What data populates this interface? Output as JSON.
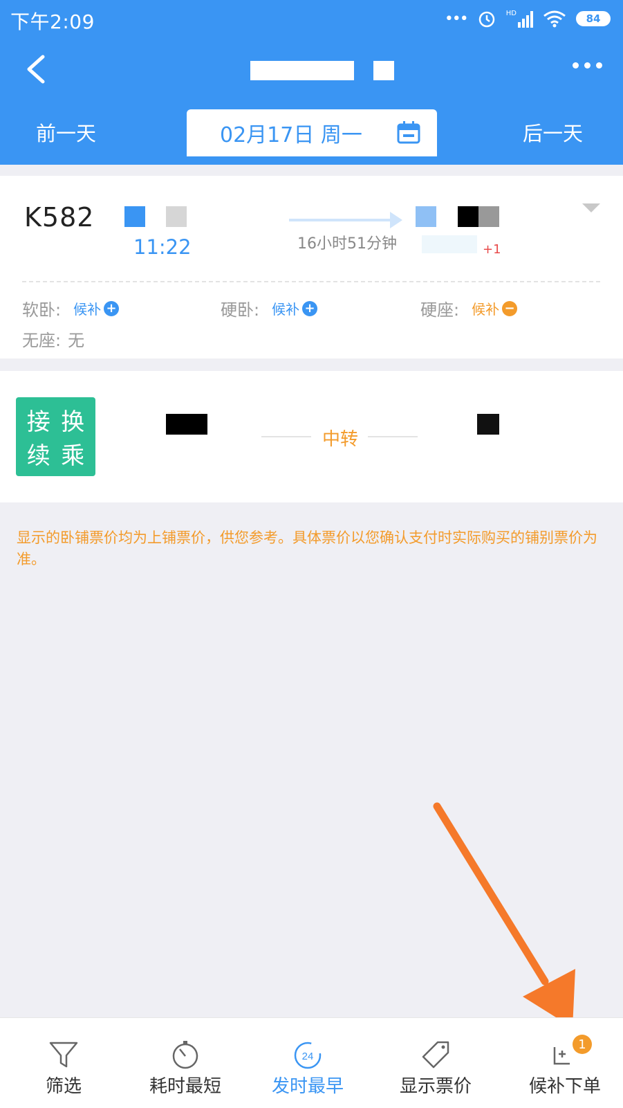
{
  "status_bar": {
    "time": "下午2:09",
    "battery": "84",
    "signal_label": "HD"
  },
  "header": {
    "prev_day": "前一天",
    "next_day": "后一天",
    "date": "02月17日 周一"
  },
  "train": {
    "number": "K582",
    "depart_time": "11:22",
    "duration": "16小时51分钟",
    "arrive_day_offset": "+1",
    "seats": [
      {
        "label": "软卧:",
        "status": "候补",
        "icon": "plus-circle-icon",
        "color": "#3a95f3"
      },
      {
        "label": "硬卧:",
        "status": "候补",
        "icon": "plus-circle-icon",
        "color": "#3a95f3"
      },
      {
        "label": "硬座:",
        "status": "候补",
        "icon": "minus-circle-icon",
        "color": "#f39b2b"
      },
      {
        "label": "无座:",
        "status": "无"
      }
    ]
  },
  "transfer": {
    "badge": [
      "接",
      "换",
      "续",
      "乘"
    ],
    "label": "中转"
  },
  "notice": "显示的卧铺票价均为上铺票价，供您参考。具体票价以您确认支付时实际购买的铺别票价为准。",
  "bottom_bar": {
    "items": [
      {
        "label": "筛选",
        "icon": "filter-icon"
      },
      {
        "label": "耗时最短",
        "icon": "stopwatch-icon"
      },
      {
        "label": "发时最早",
        "icon": "clock-24-icon",
        "active": true,
        "clock_text": "24"
      },
      {
        "label": "显示票价",
        "icon": "price-tag-icon"
      },
      {
        "label": "候补下单",
        "icon": "waitlist-icon",
        "badge": "1"
      }
    ]
  },
  "colors": {
    "primary": "#3a95f3",
    "accent": "#f39b2b",
    "transfer_green": "#2dbf95",
    "arrow": "#f5792a"
  }
}
